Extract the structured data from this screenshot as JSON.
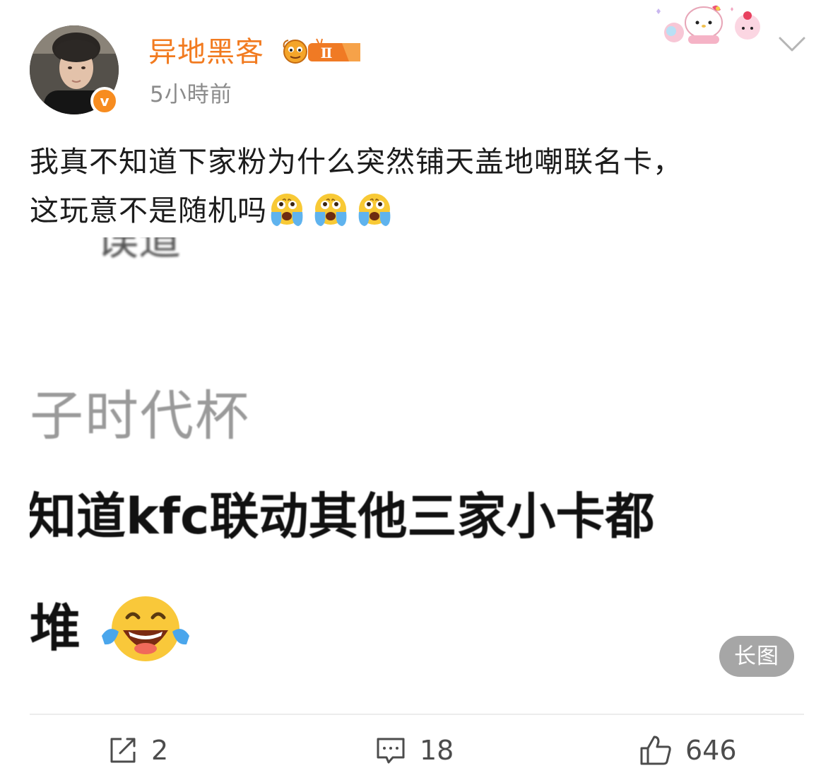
{
  "post": {
    "username": "异地黑客",
    "badge_level": "Ⅱ",
    "timestamp": "5小時前",
    "text_line1": "我真不知道下家粉为什么突然铺天盖地嘲联名卡，",
    "text_line2": "这玩意不是随机吗",
    "verified_mark": "v",
    "inline_emojis": [
      "crying-emoji",
      "crying-emoji",
      "crying-emoji"
    ]
  },
  "embedded_image": {
    "line_cutoff": "误道",
    "line1": "子时代杯",
    "line2": "知道kfc联动其他三家小卡都",
    "line3": "堆",
    "long_image_label": "长图"
  },
  "actions": {
    "repost_count": "2",
    "comment_count": "18",
    "like_count": "646"
  },
  "colors": {
    "username": "#f27b20",
    "verified": "#f78c1f",
    "timestamp": "#8b8b8b",
    "long_image_tag": "#a6a6a6"
  }
}
